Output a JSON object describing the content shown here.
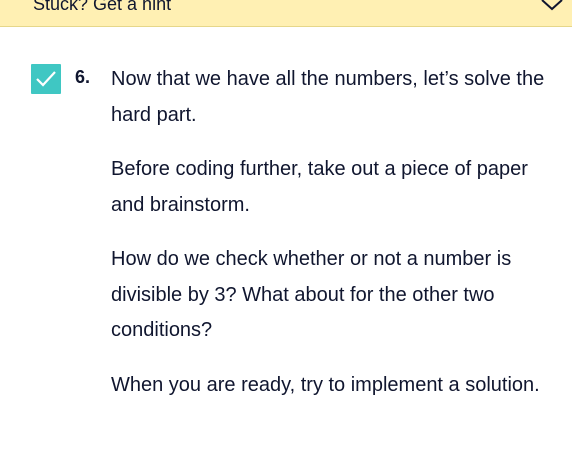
{
  "hint_bar": {
    "label": "Stuck? Get a hint",
    "chevron_icon": "chevron-down-icon",
    "background": "#fff0b3"
  },
  "task": {
    "completed": true,
    "check_color": "#3fc7c3",
    "number": "6.",
    "paragraphs": [
      "Now that we have all the numbers, let’s solve the hard part.",
      "Before coding further, take out a piece of paper and brainstorm.",
      "How do we check whether or not a number is divisible by 3? What about for the other two conditions?",
      "When you are ready, try to implement a solution."
    ]
  }
}
